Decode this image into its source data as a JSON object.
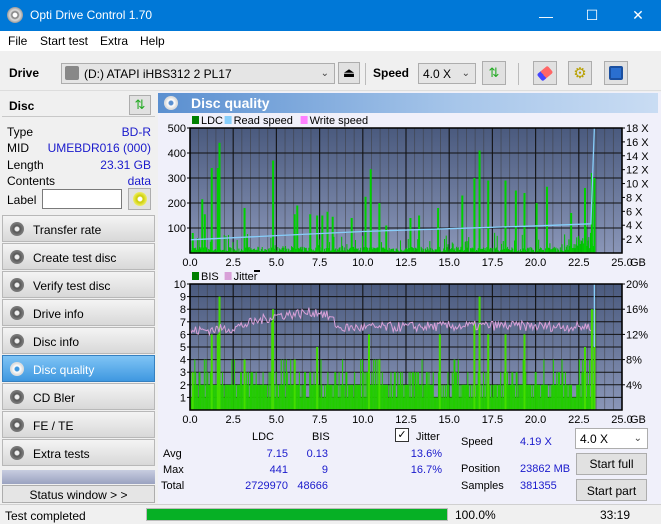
{
  "window": {
    "title": "Opti Drive Control 1.70",
    "minimize_icon": "—",
    "maximize_icon": "☐",
    "close_icon": "✕"
  },
  "menu": [
    "File",
    "Start test",
    "Extra",
    "Help"
  ],
  "toolbar": {
    "drive_label": "Drive",
    "drive_value": "(D:)   ATAPI iHBS312   2 PL17",
    "speed_label": "Speed",
    "speed_value": "4.0 X"
  },
  "disc": {
    "header": "Disc",
    "rows": [
      {
        "key": "Type",
        "value": "BD-R"
      },
      {
        "key": "MID",
        "value": "UMEBDR016 (000)"
      },
      {
        "key": "Length",
        "value": "23.31 GB"
      },
      {
        "key": "Contents",
        "value": "data"
      }
    ],
    "label_key": "Label",
    "label_value": ""
  },
  "nav": [
    {
      "label": "Transfer rate",
      "active": false
    },
    {
      "label": "Create test disc",
      "active": false
    },
    {
      "label": "Verify test disc",
      "active": false
    },
    {
      "label": "Drive info",
      "active": false
    },
    {
      "label": "Disc info",
      "active": false
    },
    {
      "label": "Disc quality",
      "active": true
    },
    {
      "label": "CD Bler",
      "active": false
    },
    {
      "label": "FE / TE",
      "active": false
    },
    {
      "label": "Extra tests",
      "active": false
    }
  ],
  "status_window_label": "Status window > >",
  "panel_title": "Disc quality",
  "chart_data": [
    {
      "type": "bar",
      "title": "LDC",
      "legend": [
        {
          "name": "LDC",
          "color": "#008000"
        },
        {
          "name": "Read speed",
          "color": "#87cefa"
        },
        {
          "name": "Write speed",
          "color": "#ff80ff"
        }
      ],
      "xlabel": "GB",
      "xlim": [
        0,
        25
      ],
      "x_ticks": [
        "0.0",
        "2.5",
        "5.0",
        "7.5",
        "10.0",
        "12.5",
        "15.0",
        "17.5",
        "20.0",
        "22.5",
        "25.0"
      ],
      "ylim": [
        0,
        500
      ],
      "y_ticks": [
        "100",
        "200",
        "300",
        "400",
        "500"
      ],
      "y2lim": [
        0,
        18
      ],
      "y2_ticks": [
        "2 X",
        "4 X",
        "6 X",
        "8 X",
        "10 X",
        "12 X",
        "14 X",
        "16 X",
        "18 X"
      ],
      "grid": true,
      "data_end_gb": 23.4,
      "ldc_peaks": [
        {
          "x": 0.1,
          "y": 80
        },
        {
          "x": 0.65,
          "y": 215
        },
        {
          "x": 0.8,
          "y": 155
        },
        {
          "x": 1.2,
          "y": 340
        },
        {
          "x": 1.55,
          "y": 340
        },
        {
          "x": 1.65,
          "y": 441
        },
        {
          "x": 3.1,
          "y": 180
        },
        {
          "x": 4.75,
          "y": 370
        },
        {
          "x": 6.0,
          "y": 155
        },
        {
          "x": 6.15,
          "y": 190
        },
        {
          "x": 6.9,
          "y": 155
        },
        {
          "x": 7.3,
          "y": 150
        },
        {
          "x": 7.6,
          "y": 150
        },
        {
          "x": 7.9,
          "y": 165
        },
        {
          "x": 8.2,
          "y": 145
        },
        {
          "x": 9.3,
          "y": 140
        },
        {
          "x": 10.1,
          "y": 225
        },
        {
          "x": 10.4,
          "y": 335
        },
        {
          "x": 10.9,
          "y": 200
        },
        {
          "x": 11.3,
          "y": 110
        },
        {
          "x": 12.7,
          "y": 140
        },
        {
          "x": 13.2,
          "y": 150
        },
        {
          "x": 14.3,
          "y": 180
        },
        {
          "x": 15.7,
          "y": 230
        },
        {
          "x": 16.4,
          "y": 300
        },
        {
          "x": 16.7,
          "y": 410
        },
        {
          "x": 17.2,
          "y": 290
        },
        {
          "x": 18.2,
          "y": 290
        },
        {
          "x": 18.8,
          "y": 250
        },
        {
          "x": 19.3,
          "y": 240
        },
        {
          "x": 20.0,
          "y": 200
        },
        {
          "x": 20.6,
          "y": 265
        },
        {
          "x": 22.0,
          "y": 160
        },
        {
          "x": 22.8,
          "y": 260
        },
        {
          "x": 23.2,
          "y": 320
        },
        {
          "x": 23.35,
          "y": 300
        }
      ],
      "read_speed": [
        {
          "x": 0,
          "y": 1.9
        },
        {
          "x": 5,
          "y": 2.5
        },
        {
          "x": 10,
          "y": 3.1
        },
        {
          "x": 15,
          "y": 3.5
        },
        {
          "x": 20,
          "y": 3.9
        },
        {
          "x": 23.2,
          "y": 4.2
        },
        {
          "x": 23.4,
          "y": 18
        }
      ]
    },
    {
      "type": "bar",
      "title": "BIS",
      "legend": [
        {
          "name": "BIS",
          "color": "#008000"
        },
        {
          "name": "Jitter",
          "color": "#d8a0d8"
        }
      ],
      "xlabel": "GB",
      "xlim": [
        0,
        25
      ],
      "x_ticks": [
        "0.0",
        "2.5",
        "5.0",
        "7.5",
        "10.0",
        "12.5",
        "15.0",
        "17.5",
        "20.0",
        "22.5",
        "25.0"
      ],
      "ylim": [
        0,
        10
      ],
      "y_ticks": [
        "1",
        "2",
        "3",
        "4",
        "5",
        "6",
        "7",
        "8",
        "9",
        "10"
      ],
      "y2lim": [
        0,
        20
      ],
      "y2_ticks": [
        "4%",
        "8%",
        "12%",
        "16%",
        "20%"
      ],
      "grid": true,
      "data_end_gb": 23.4,
      "bis_peaks": [
        {
          "x": 0.1,
          "y": 3
        },
        {
          "x": 1.2,
          "y": 6
        },
        {
          "x": 1.55,
          "y": 6
        },
        {
          "x": 1.65,
          "y": 9
        },
        {
          "x": 3.1,
          "y": 4
        },
        {
          "x": 4.75,
          "y": 8
        },
        {
          "x": 4.7,
          "y": 7
        },
        {
          "x": 6.0,
          "y": 4
        },
        {
          "x": 7.3,
          "y": 5
        },
        {
          "x": 10.3,
          "y": 6
        },
        {
          "x": 10.9,
          "y": 4
        },
        {
          "x": 14.4,
          "y": 6
        },
        {
          "x": 16.4,
          "y": 7
        },
        {
          "x": 16.7,
          "y": 9
        },
        {
          "x": 17.2,
          "y": 6
        },
        {
          "x": 18.2,
          "y": 6
        },
        {
          "x": 19.3,
          "y": 6
        },
        {
          "x": 22.8,
          "y": 5
        },
        {
          "x": 23.2,
          "y": 8
        },
        {
          "x": 23.35,
          "y": 8
        }
      ],
      "jitter": [
        {
          "x": 0,
          "y": 12.5
        },
        {
          "x": 2.5,
          "y": 13
        },
        {
          "x": 5,
          "y": 15
        },
        {
          "x": 7.5,
          "y": 15.6
        },
        {
          "x": 8.2,
          "y": 14.5
        },
        {
          "x": 8.6,
          "y": 13
        },
        {
          "x": 12.5,
          "y": 13.2
        },
        {
          "x": 17.5,
          "y": 13.4
        },
        {
          "x": 22.5,
          "y": 13.2
        },
        {
          "x": 23.2,
          "y": 13.3
        }
      ]
    }
  ],
  "stats": {
    "col_ldc": "LDC",
    "col_bis": "BIS",
    "jitter_label": "Jitter",
    "jitter_checked": true,
    "avg_label": "Avg",
    "max_label": "Max",
    "total_label": "Total",
    "avg_ldc": "7.15",
    "avg_bis": "0.13",
    "avg_jitter": "13.6%",
    "max_ldc": "441",
    "max_bis": "9",
    "max_jitter": "16.7%",
    "total_ldc": "2729970",
    "total_bis": "48666",
    "speed_label": "Speed",
    "speed_value": "4.19 X",
    "position_label": "Position",
    "position_value": "23862 MB",
    "samples_label": "Samples",
    "samples_value": "381355",
    "speed_select": "4.0 X",
    "start_full": "Start full",
    "start_part": "Start part"
  },
  "statusbar": {
    "text": "Test completed",
    "progress": 100.0,
    "progress_text": "100.0%",
    "time": "33:19"
  }
}
